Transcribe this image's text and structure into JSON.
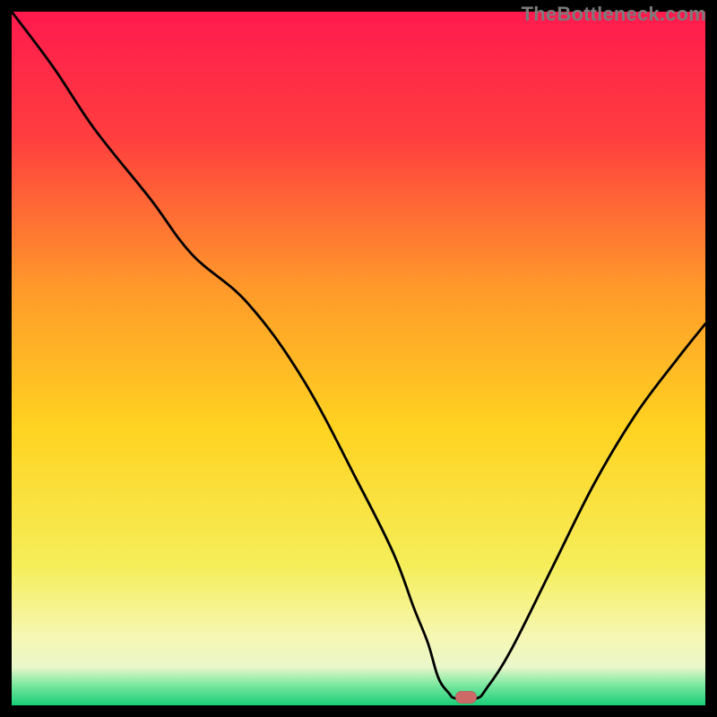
{
  "watermark": "TheBottleneck.com",
  "colors": {
    "black": "#000000",
    "curve": "#000000",
    "marker": "#cd6a67",
    "gradient_stops": [
      {
        "offset": 0.0,
        "color": "#ff1a4e"
      },
      {
        "offset": 0.18,
        "color": "#ff3e3f"
      },
      {
        "offset": 0.4,
        "color": "#ff9a2a"
      },
      {
        "offset": 0.6,
        "color": "#ffd321"
      },
      {
        "offset": 0.8,
        "color": "#f5ee5a"
      },
      {
        "offset": 0.9,
        "color": "#f6f7b2"
      },
      {
        "offset": 0.945,
        "color": "#e9f7ca"
      },
      {
        "offset": 0.97,
        "color": "#7de8a0"
      },
      {
        "offset": 1.0,
        "color": "#19ce78"
      }
    ]
  },
  "chart_data": {
    "type": "line",
    "title": "",
    "xlabel": "",
    "ylabel": "",
    "xlim": [
      0,
      100
    ],
    "ylim": [
      0,
      100
    ],
    "grid": false,
    "legend": false,
    "marker": {
      "x": 65.5,
      "y": 1.2,
      "color": "#cd6a67"
    },
    "series": [
      {
        "name": "bottleneck-curve",
        "x": [
          0,
          6,
          12,
          20,
          26,
          34,
          42,
          50,
          55,
          58,
          60,
          61.5,
          63,
          64,
          67,
          68.5,
          72,
          78,
          84,
          90,
          96,
          100
        ],
        "y": [
          100,
          92,
          83,
          73,
          65,
          58,
          47,
          32,
          22,
          14,
          9,
          4,
          1.8,
          1.0,
          1.0,
          2.5,
          8,
          20,
          32,
          42,
          50,
          55
        ]
      }
    ]
  }
}
